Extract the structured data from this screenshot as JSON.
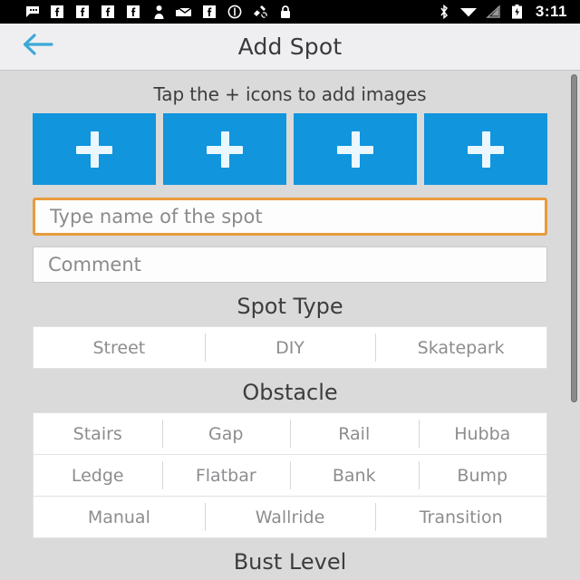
{
  "statusbar": {
    "time": "3:11",
    "left_icons": [
      {
        "name": "sms-icon",
        "label": "sms"
      },
      {
        "name": "facebook-icon-1",
        "label": "facebook"
      },
      {
        "name": "facebook-icon-2",
        "label": "facebook"
      },
      {
        "name": "facebook-icon-3",
        "label": "facebook"
      },
      {
        "name": "facebook-icon-4",
        "label": "facebook"
      },
      {
        "name": "contact-icon",
        "label": "contact"
      },
      {
        "name": "email-icon",
        "label": "email"
      },
      {
        "name": "facebook-icon-5",
        "label": "facebook"
      },
      {
        "name": "alert-circle-icon",
        "label": "alert"
      },
      {
        "name": "gps-satellite-icon",
        "label": "gps"
      },
      {
        "name": "lock-icon",
        "label": "lock"
      }
    ],
    "right_icons": [
      {
        "name": "bluetooth-icon",
        "label": "bluetooth"
      },
      {
        "name": "wifi-icon",
        "label": "wifi"
      },
      {
        "name": "cell-signal-icon",
        "label": "signal"
      },
      {
        "name": "battery-charging-icon",
        "label": "battery"
      }
    ]
  },
  "header": {
    "title": "Add Spot",
    "back_icon": "arrow-left-icon",
    "accent_color": "#3ba9d8",
    "background": "#efeff1"
  },
  "main": {
    "hint": "Tap the + icons to add images",
    "image_tiles": [
      {
        "label": "+"
      },
      {
        "label": "+"
      },
      {
        "label": "+"
      },
      {
        "label": "+"
      }
    ],
    "tile_color": "#1195dc",
    "name_field": {
      "value": "",
      "placeholder": "Type name of the spot",
      "focus_border_color": "#e79b3c"
    },
    "comment_field": {
      "value": "",
      "placeholder": "Comment",
      "border_color": "#c9c9cb"
    },
    "sections": [
      {
        "title": "Spot Type",
        "rows": [
          [
            "Street",
            "DIY",
            "Skatepark"
          ]
        ]
      },
      {
        "title": "Obstacle",
        "rows": [
          [
            "Stairs",
            "Gap",
            "Rail",
            "Hubba"
          ],
          [
            "Ledge",
            "Flatbar",
            "Bank",
            "Bump"
          ],
          [
            "Manual",
            "Wallride",
            "Transition"
          ]
        ]
      },
      {
        "title": "Bust Level",
        "rows": []
      }
    ]
  },
  "scrollbar": {
    "visible": true,
    "color": "#8a8a8c"
  }
}
